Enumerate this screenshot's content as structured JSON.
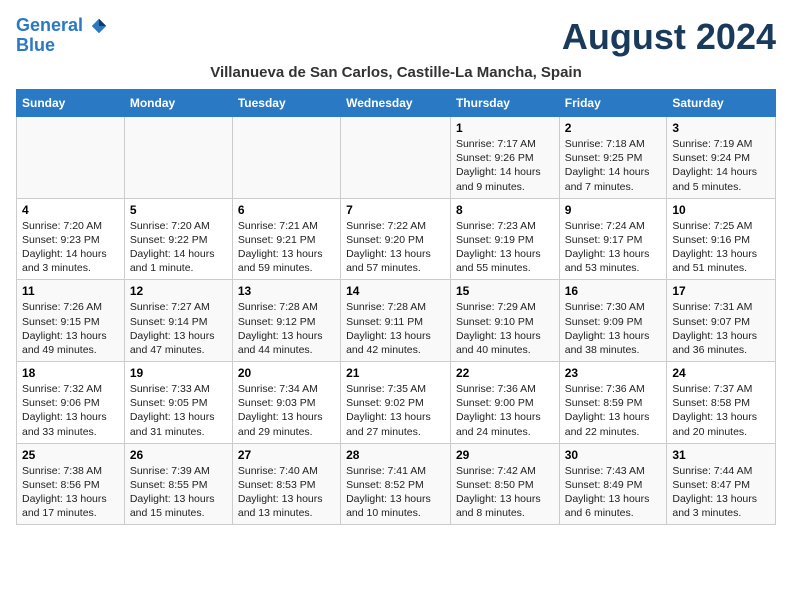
{
  "logo": {
    "line1": "General",
    "line2": "Blue"
  },
  "title": "August 2024",
  "subtitle": "Villanueva de San Carlos, Castille-La Mancha, Spain",
  "days_of_week": [
    "Sunday",
    "Monday",
    "Tuesday",
    "Wednesday",
    "Thursday",
    "Friday",
    "Saturday"
  ],
  "weeks": [
    [
      {
        "num": "",
        "info": ""
      },
      {
        "num": "",
        "info": ""
      },
      {
        "num": "",
        "info": ""
      },
      {
        "num": "",
        "info": ""
      },
      {
        "num": "1",
        "info": "Sunrise: 7:17 AM\nSunset: 9:26 PM\nDaylight: 14 hours\nand 9 minutes."
      },
      {
        "num": "2",
        "info": "Sunrise: 7:18 AM\nSunset: 9:25 PM\nDaylight: 14 hours\nand 7 minutes."
      },
      {
        "num": "3",
        "info": "Sunrise: 7:19 AM\nSunset: 9:24 PM\nDaylight: 14 hours\nand 5 minutes."
      }
    ],
    [
      {
        "num": "4",
        "info": "Sunrise: 7:20 AM\nSunset: 9:23 PM\nDaylight: 14 hours\nand 3 minutes."
      },
      {
        "num": "5",
        "info": "Sunrise: 7:20 AM\nSunset: 9:22 PM\nDaylight: 14 hours\nand 1 minute."
      },
      {
        "num": "6",
        "info": "Sunrise: 7:21 AM\nSunset: 9:21 PM\nDaylight: 13 hours\nand 59 minutes."
      },
      {
        "num": "7",
        "info": "Sunrise: 7:22 AM\nSunset: 9:20 PM\nDaylight: 13 hours\nand 57 minutes."
      },
      {
        "num": "8",
        "info": "Sunrise: 7:23 AM\nSunset: 9:19 PM\nDaylight: 13 hours\nand 55 minutes."
      },
      {
        "num": "9",
        "info": "Sunrise: 7:24 AM\nSunset: 9:17 PM\nDaylight: 13 hours\nand 53 minutes."
      },
      {
        "num": "10",
        "info": "Sunrise: 7:25 AM\nSunset: 9:16 PM\nDaylight: 13 hours\nand 51 minutes."
      }
    ],
    [
      {
        "num": "11",
        "info": "Sunrise: 7:26 AM\nSunset: 9:15 PM\nDaylight: 13 hours\nand 49 minutes."
      },
      {
        "num": "12",
        "info": "Sunrise: 7:27 AM\nSunset: 9:14 PM\nDaylight: 13 hours\nand 47 minutes."
      },
      {
        "num": "13",
        "info": "Sunrise: 7:28 AM\nSunset: 9:12 PM\nDaylight: 13 hours\nand 44 minutes."
      },
      {
        "num": "14",
        "info": "Sunrise: 7:28 AM\nSunset: 9:11 PM\nDaylight: 13 hours\nand 42 minutes."
      },
      {
        "num": "15",
        "info": "Sunrise: 7:29 AM\nSunset: 9:10 PM\nDaylight: 13 hours\nand 40 minutes."
      },
      {
        "num": "16",
        "info": "Sunrise: 7:30 AM\nSunset: 9:09 PM\nDaylight: 13 hours\nand 38 minutes."
      },
      {
        "num": "17",
        "info": "Sunrise: 7:31 AM\nSunset: 9:07 PM\nDaylight: 13 hours\nand 36 minutes."
      }
    ],
    [
      {
        "num": "18",
        "info": "Sunrise: 7:32 AM\nSunset: 9:06 PM\nDaylight: 13 hours\nand 33 minutes."
      },
      {
        "num": "19",
        "info": "Sunrise: 7:33 AM\nSunset: 9:05 PM\nDaylight: 13 hours\nand 31 minutes."
      },
      {
        "num": "20",
        "info": "Sunrise: 7:34 AM\nSunset: 9:03 PM\nDaylight: 13 hours\nand 29 minutes."
      },
      {
        "num": "21",
        "info": "Sunrise: 7:35 AM\nSunset: 9:02 PM\nDaylight: 13 hours\nand 27 minutes."
      },
      {
        "num": "22",
        "info": "Sunrise: 7:36 AM\nSunset: 9:00 PM\nDaylight: 13 hours\nand 24 minutes."
      },
      {
        "num": "23",
        "info": "Sunrise: 7:36 AM\nSunset: 8:59 PM\nDaylight: 13 hours\nand 22 minutes."
      },
      {
        "num": "24",
        "info": "Sunrise: 7:37 AM\nSunset: 8:58 PM\nDaylight: 13 hours\nand 20 minutes."
      }
    ],
    [
      {
        "num": "25",
        "info": "Sunrise: 7:38 AM\nSunset: 8:56 PM\nDaylight: 13 hours\nand 17 minutes."
      },
      {
        "num": "26",
        "info": "Sunrise: 7:39 AM\nSunset: 8:55 PM\nDaylight: 13 hours\nand 15 minutes."
      },
      {
        "num": "27",
        "info": "Sunrise: 7:40 AM\nSunset: 8:53 PM\nDaylight: 13 hours\nand 13 minutes."
      },
      {
        "num": "28",
        "info": "Sunrise: 7:41 AM\nSunset: 8:52 PM\nDaylight: 13 hours\nand 10 minutes."
      },
      {
        "num": "29",
        "info": "Sunrise: 7:42 AM\nSunset: 8:50 PM\nDaylight: 13 hours\nand 8 minutes."
      },
      {
        "num": "30",
        "info": "Sunrise: 7:43 AM\nSunset: 8:49 PM\nDaylight: 13 hours\nand 6 minutes."
      },
      {
        "num": "31",
        "info": "Sunrise: 7:44 AM\nSunset: 8:47 PM\nDaylight: 13 hours\nand 3 minutes."
      }
    ]
  ]
}
